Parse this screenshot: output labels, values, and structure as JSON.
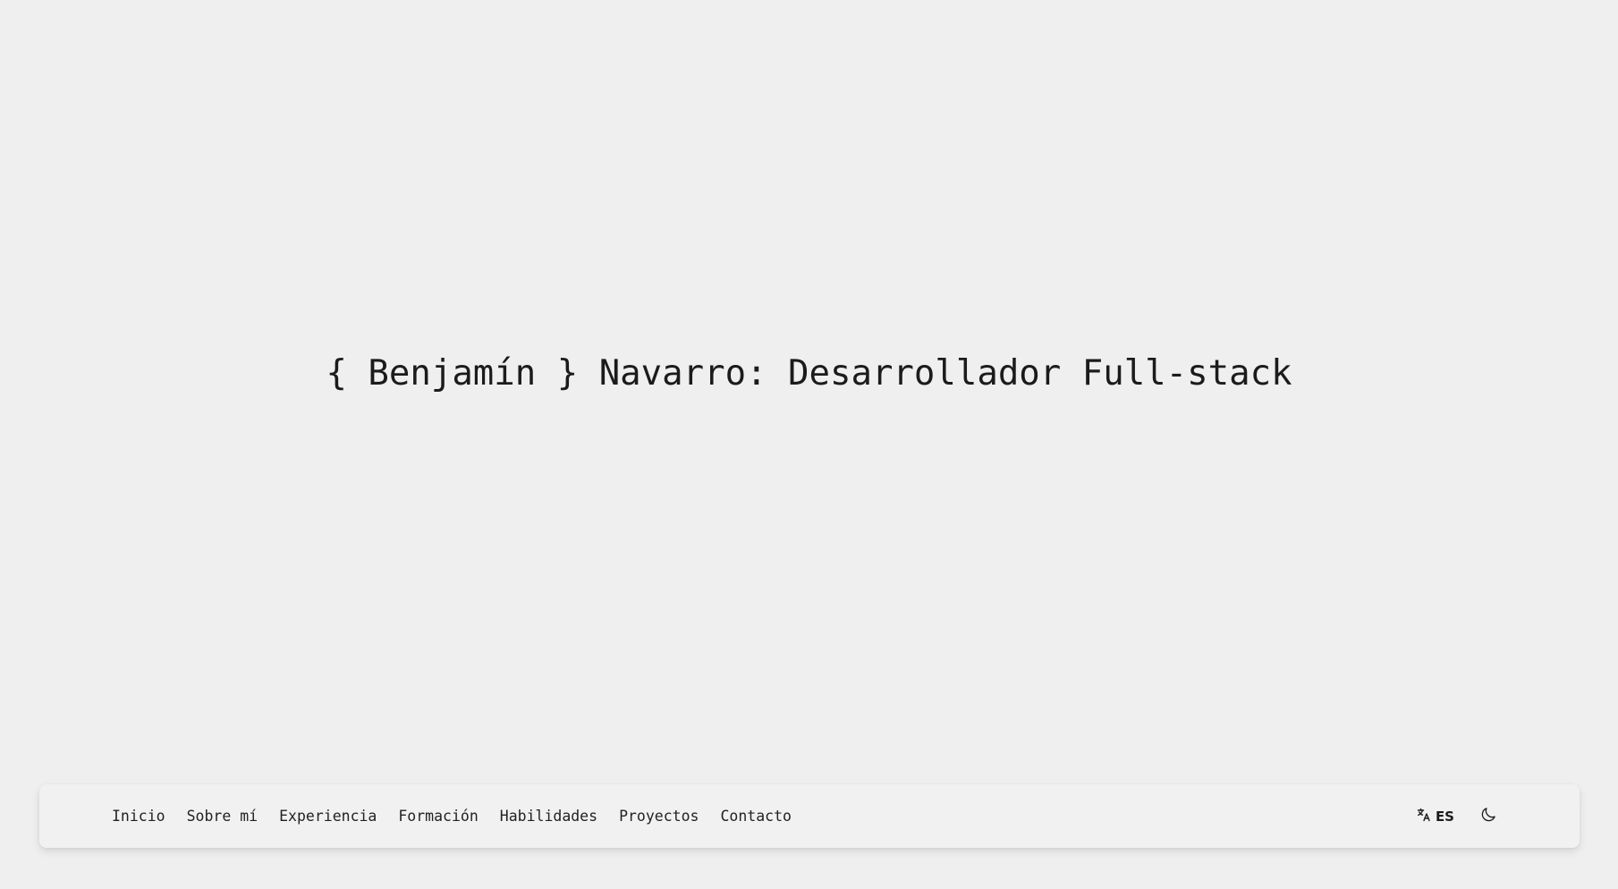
{
  "hero": {
    "open_brace": "{",
    "first_name": "Benjamín",
    "close_brace": "}",
    "rest": "Navarro: Desarrollador Full-stack"
  },
  "nav": {
    "links": [
      {
        "label": "Inicio"
      },
      {
        "label": "Sobre mí"
      },
      {
        "label": "Experiencia"
      },
      {
        "label": "Formación"
      },
      {
        "label": "Habilidades"
      },
      {
        "label": "Proyectos"
      },
      {
        "label": "Contacto"
      }
    ],
    "language": {
      "icon": "translate-icon",
      "code": "ES"
    },
    "theme_toggle": {
      "icon": "moon-icon"
    }
  },
  "colors": {
    "background": "#efefef",
    "navbar": "#f1f1f1",
    "text": "#1b1b1b"
  }
}
